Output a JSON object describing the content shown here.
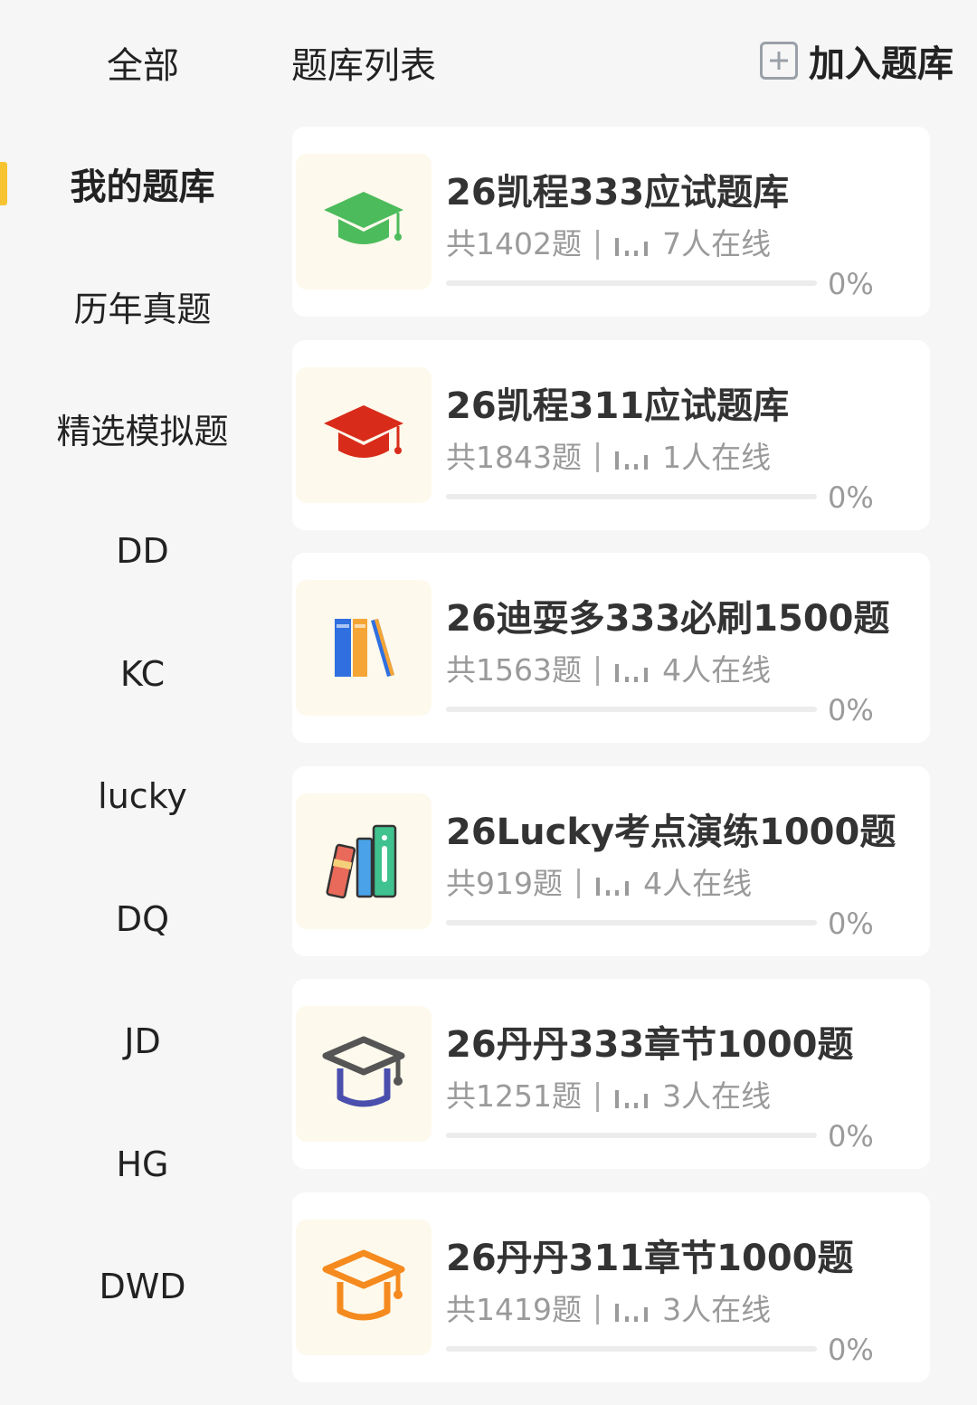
{
  "header": {
    "all_label": "全部",
    "list_label": "题库列表",
    "join_label": "加入题库"
  },
  "sidebar": {
    "items": [
      {
        "label": "我的题库",
        "active": true
      },
      {
        "label": "历年真题"
      },
      {
        "label": "精选模拟题"
      },
      {
        "label": "DD"
      },
      {
        "label": "KC"
      },
      {
        "label": "lucky"
      },
      {
        "label": "DQ"
      },
      {
        "label": "JD"
      },
      {
        "label": "HG"
      },
      {
        "label": "DWD"
      }
    ]
  },
  "banks": [
    {
      "title": "26凯程333应试题库",
      "count": "共1402题",
      "online": "7人在线",
      "progress": 0,
      "progress_label": "0%",
      "icon": "graduation-cap-icon",
      "color": "#4cbb5c"
    },
    {
      "title": "26凯程311应试题库",
      "count": "共1843题",
      "online": "1人在线",
      "progress": 0,
      "progress_label": "0%",
      "icon": "graduation-cap-icon",
      "color": "#d92b1a"
    },
    {
      "title": "26迪耍多333必刷1500题",
      "count": "共1563题",
      "online": "4人在线",
      "progress": 0,
      "progress_label": "0%",
      "icon": "books-icon",
      "color": "#f2a03a"
    },
    {
      "title": "26Lucky考点演练1000题",
      "count": "共919题",
      "online": "4人在线",
      "progress": 0,
      "progress_label": "0%",
      "icon": "book-stack-icon",
      "color": "#3fc28e"
    },
    {
      "title": "26丹丹333章节1000题",
      "count": "共1251题",
      "online": "3人在线",
      "progress": 0,
      "progress_label": "0%",
      "icon": "graduation-cap-outline-icon",
      "color": "#4a4fae"
    },
    {
      "title": "26丹丹311章节1000题",
      "count": "共1419题",
      "online": "3人在线",
      "progress": 0,
      "progress_label": "0%",
      "icon": "graduation-cap-outline-icon",
      "color": "#f58a1f"
    }
  ],
  "icons": {
    "separator": "|",
    "online_icon": "signal-bars-icon"
  }
}
